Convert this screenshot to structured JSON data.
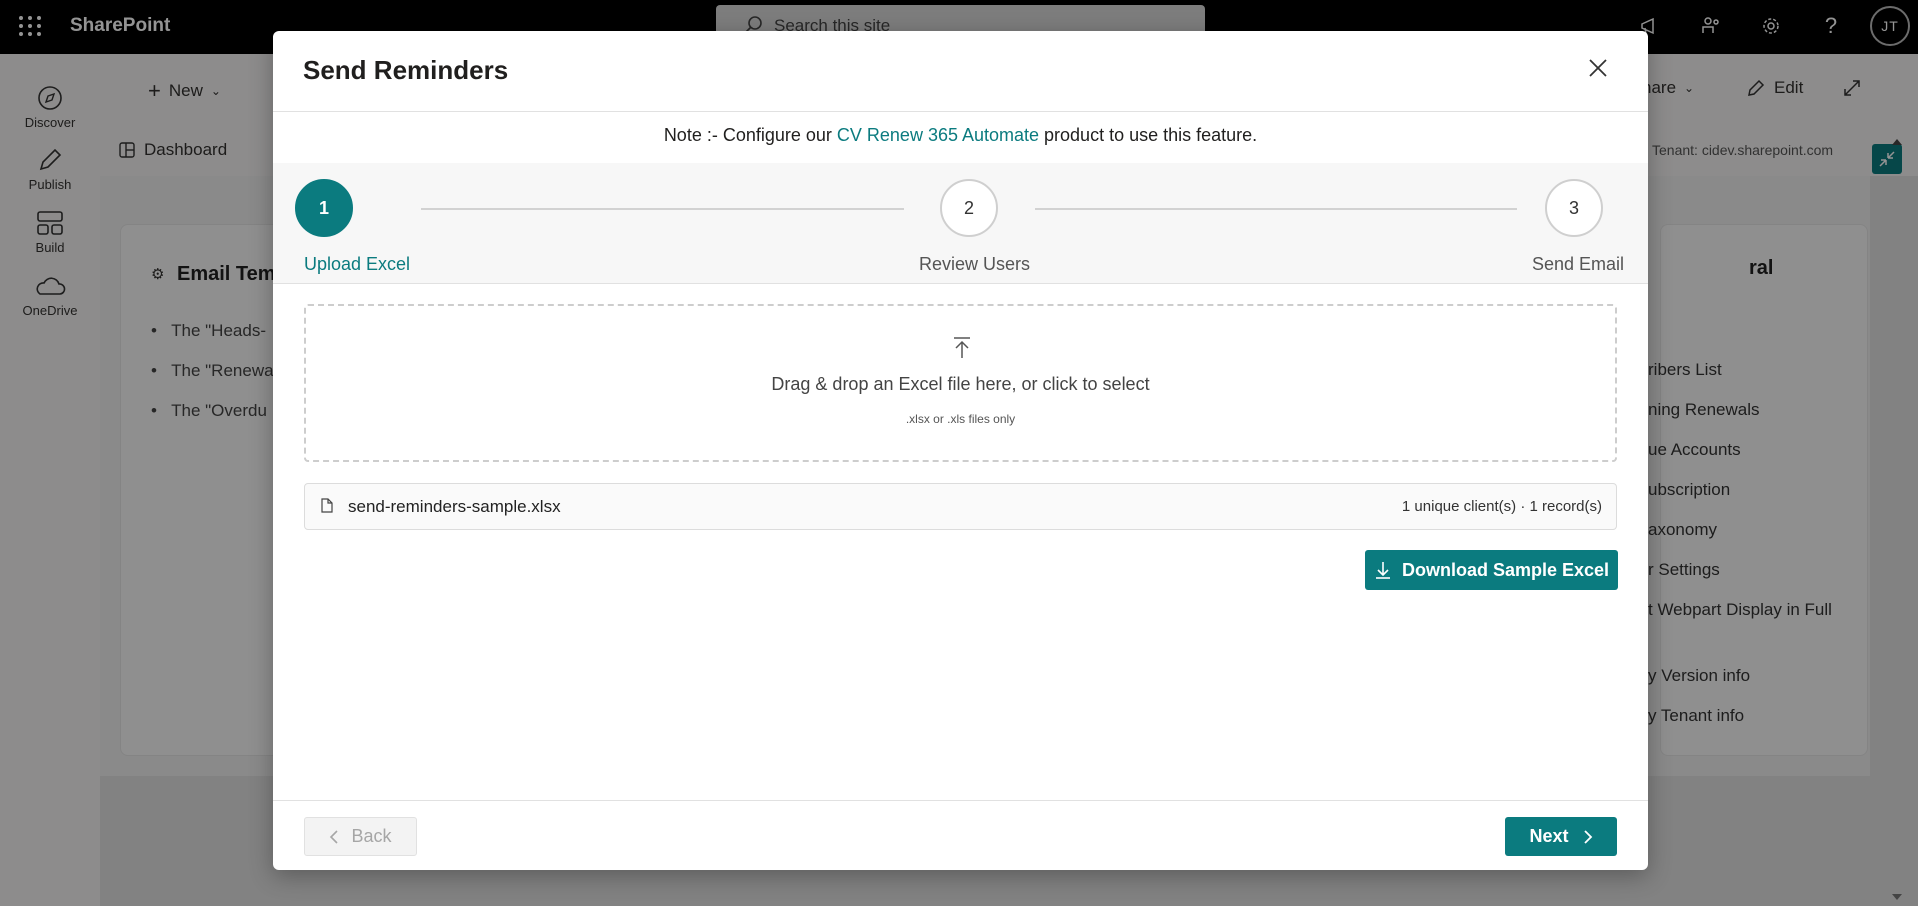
{
  "suite": {
    "brand": "SharePoint",
    "search_placeholder": "Search this site",
    "avatar_initials": "JT"
  },
  "rail": {
    "items": [
      {
        "label": "Discover",
        "icon": "compass-icon"
      },
      {
        "label": "Publish",
        "icon": "pen-icon"
      },
      {
        "label": "Build",
        "icon": "grid-icon"
      },
      {
        "label": "OneDrive",
        "icon": "cloud-icon"
      }
    ]
  },
  "page": {
    "command_bar": {
      "new_label": "New",
      "share_label": "hare",
      "edit_label": "Edit"
    },
    "tabs": {
      "dashboard_label": "Dashboard"
    },
    "tenant_label": "Tenant: cidev.sharepoint.com",
    "email_card": {
      "title": "Email Temp",
      "bullets": [
        "The \"Heads-",
        "The \"Renewa",
        "The \"Overdu"
      ]
    },
    "right_card": {
      "title": "ral",
      "items": [
        "ribers List",
        "ning Renewals",
        "ue Accounts",
        "ubscription",
        "axonomy",
        "r Settings",
        "t Webpart Display in Full",
        "y Version info",
        "y Tenant info"
      ]
    }
  },
  "modal": {
    "title": "Send Reminders",
    "note": {
      "prefix": "Note :- Configure our ",
      "link": "CV Renew 365 Automate",
      "suffix": " product to use this feature."
    },
    "steps": [
      {
        "number": "1",
        "label": "Upload Excel",
        "active": true
      },
      {
        "number": "2",
        "label": "Review Users",
        "active": false
      },
      {
        "number": "3",
        "label": "Send Email",
        "active": false
      }
    ],
    "dropzone": {
      "text": "Drag & drop an Excel file here, or click to select",
      "subtext": ".xlsx or .xls files only"
    },
    "file": {
      "name": "send-reminders-sample.xlsx",
      "meta": "1 unique client(s) · 1 record(s)"
    },
    "download_label": "Download Sample Excel",
    "back_label": "Back",
    "next_label": "Next"
  },
  "colors": {
    "accent": "#0b7b7f",
    "header": "#000000"
  }
}
